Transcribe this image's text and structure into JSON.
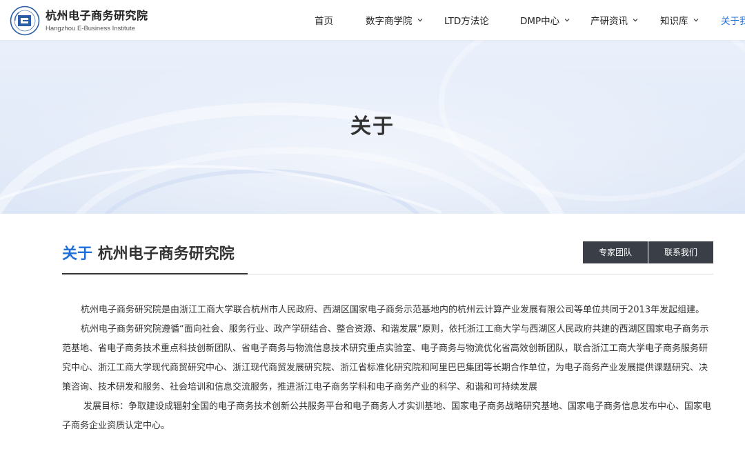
{
  "site": {
    "name_cn": "杭州电子商务研究院",
    "name_en": "Hangzhou E-Business Institute"
  },
  "nav": [
    {
      "label": "首页",
      "dropdown": false,
      "active": false
    },
    {
      "label": "数字商学院",
      "dropdown": true,
      "active": false
    },
    {
      "label": "LTD方法论",
      "dropdown": false,
      "active": false
    },
    {
      "label": "DMP中心",
      "dropdown": true,
      "active": false
    },
    {
      "label": "产研资讯",
      "dropdown": true,
      "active": false
    },
    {
      "label": "知识库",
      "dropdown": true,
      "active": false
    },
    {
      "label": "关于我",
      "dropdown": false,
      "active": true
    }
  ],
  "banner": {
    "title": "关于"
  },
  "section": {
    "title_accent": "关于",
    "title_rest": "杭州电子商务研究院",
    "buttons": [
      "专家团队",
      "联系我们"
    ]
  },
  "content": {
    "para1": "杭州电子商务研究院是由浙江工商大学联合杭州市人民政府、西湖区国家电子商务示范基地内的杭州云计算产业发展有限公司等单位共同于2013年发起组建。",
    "para2": "杭州电子商务研究院遵循“面向社会、服务行业、政产学研结合、整合资源、和谐发展”原则，依托浙江工商大学与西湖区人民政府共建的西湖区国家电子商务示范基地、省电子商务技术重点科技创新团队、省电子商务与物流信息技术研究重点实验室、电子商务与物流优化省高效创新团队，联合浙江工商大学电子商务服务研究中心、浙江工商大学现代商贸研究中心、浙江现代商贸发展研究院、浙江省标准化研究院和阿里巴巴集团等长期合作单位，为电子商务产业发展提供课题研究、决策咨询、技术研发和服务、社会培训和信息交流服务，推进浙江电子商务学科和电子商务产业的科学、和谐和可持续发展",
    "para3": "发展目标：争取建设成辐射全国的电子商务技术创新公共服务平台和电子商务人才实训基地、国家电子商务战略研究基地、国家电子商务信息发布中心、国家电子商务企业资质认定中心。"
  },
  "colors": {
    "accent": "#1e6fd9",
    "button_bg": "#3a3f47",
    "banner_bg": "#e3ebf9"
  }
}
